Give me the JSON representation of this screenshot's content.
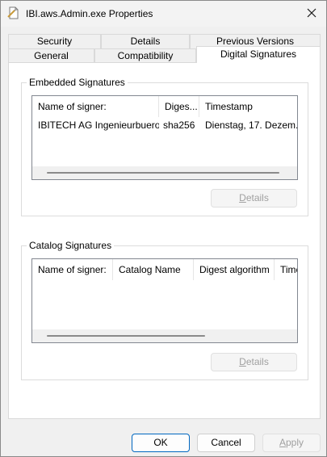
{
  "window": {
    "title": "IBI.aws.Admin.exe Properties",
    "icon": "file-properties-icon",
    "close_glyph": "close-icon"
  },
  "tabs": {
    "row1": [
      "Security",
      "Details",
      "Previous Versions"
    ],
    "row2": [
      "General",
      "Compatibility",
      "Digital Signatures"
    ],
    "selected": "Digital Signatures"
  },
  "embedded": {
    "group_label": "Embedded Signatures",
    "columns": [
      "Name of signer:",
      "Diges...",
      "Timestamp"
    ],
    "rows": [
      [
        "IBITECH AG Ingenieurbuero ...",
        "sha256",
        "Dienstag, 17. Dezem..."
      ]
    ],
    "details_button": {
      "prefix": "",
      "underline": "D",
      "suffix": "etails"
    }
  },
  "catalog": {
    "group_label": "Catalog Signatures",
    "columns": [
      "Name of signer:",
      "Catalog Name",
      "Digest algorithm",
      "Time"
    ],
    "rows": [],
    "details_button": {
      "prefix": "",
      "underline": "D",
      "suffix": "etails"
    }
  },
  "footer": {
    "ok": "OK",
    "cancel": "Cancel",
    "apply": {
      "prefix": "",
      "underline": "A",
      "suffix": "pply"
    }
  },
  "colors": {
    "primary_border": "#0067c0",
    "disabled_text": "#a0a0a0"
  }
}
